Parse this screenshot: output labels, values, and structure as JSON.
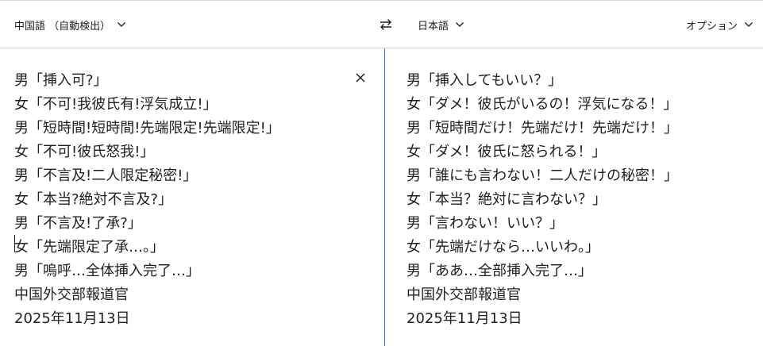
{
  "toolbar": {
    "source_language": "中国語 （自動検出）",
    "target_language": "日本語",
    "options_label": "オプション"
  },
  "source": {
    "lines": [
      "男「挿入可?」",
      "女「不可!我彼氏有!浮気成立!」",
      "男「短時間!短時間!先端限定!先端限定!」",
      "女「不可!彼氏怒我!」",
      "男「不言及!二人限定秘密!」",
      "女「本当?絶対不言及?」",
      "男「不言及!了承?」",
      "女「先端限定了承…。」",
      "男「嗚呼…全体挿入完了…」",
      "中国外交部報道官",
      "2025年11月13日"
    ]
  },
  "target": {
    "lines": [
      "男「挿入してもいい？」",
      "女「ダメ！彼氏がいるの！浮気になる！」",
      "男「短時間だけ！先端だけ！先端だけ！」",
      "女「ダメ！彼氏に怒られる！」",
      "男「誰にも言わない！二人だけの秘密！」",
      "女「本当？絶対に言わない？」",
      "男「言わない！いい？」",
      "女「先端だけなら…いいわ。」",
      "男「ああ…全部挿入完了…」",
      "中国外交部報道官",
      "2025年11月13日"
    ]
  },
  "icons": {
    "swap": "swap-languages-icon",
    "clear": "close-icon",
    "chevron": "chevron-down-icon"
  },
  "colors": {
    "accent": "#3c6ed6",
    "text": "#1f1f1f",
    "border": "#d9d9d9"
  }
}
